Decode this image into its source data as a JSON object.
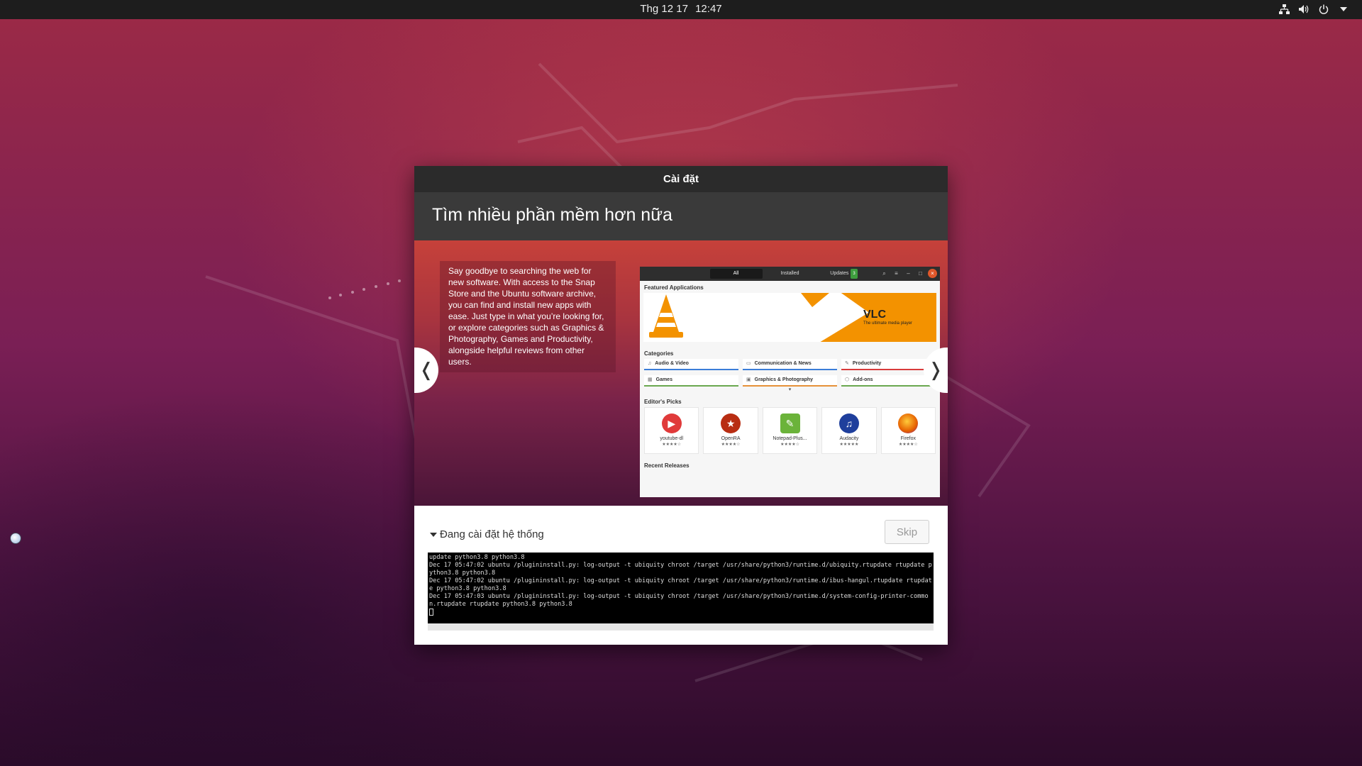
{
  "topbar": {
    "date": "Thg 12 17",
    "time": "12:47",
    "tray_icons": [
      "network-icon",
      "volume-icon",
      "power-icon",
      "dropdown-arrow-icon"
    ]
  },
  "window": {
    "title": "Cài đặt",
    "slide_title": "Tìm nhiều phần mềm hơn nữa",
    "slide_text": "Say goodbye to searching the web for new software. With access to the Snap Store and the Ubuntu software archive, you can find and install new apps with ease. Just type in what you’re looking for, or explore categories such as Graphics & Photography, Games and Productivity, alongside helpful reviews from other users.",
    "nav_prev": "❬",
    "nav_next": "❭"
  },
  "store": {
    "tabs": [
      "All",
      "Installed",
      "Updates"
    ],
    "updates_badge": "3",
    "featured_label": "Featured Applications",
    "featured_app": "VLC",
    "featured_tagline": "The ultimate media player",
    "categories_label": "Categories",
    "categories": [
      {
        "label": "Audio & Video",
        "color": "#3b7dd8"
      },
      {
        "label": "Communication & News",
        "color": "#3b7dd8"
      },
      {
        "label": "Productivity",
        "color": "#d83b3b"
      },
      {
        "label": "Games",
        "color": "#6aa84f"
      },
      {
        "label": "Graphics & Photography",
        "color": "#e69138"
      },
      {
        "label": "Add-ons",
        "color": "#6aa84f"
      }
    ],
    "editors_picks_label": "Editor's Picks",
    "picks": [
      {
        "name": "youtube-dl",
        "stars": "★★★★☆",
        "color": "#e03a3a"
      },
      {
        "name": "OpenRA",
        "stars": "★★★★☆",
        "color": "#b82d12"
      },
      {
        "name": "Notepad-Plus...",
        "stars": "★★★★☆",
        "color": "#6bb33a"
      },
      {
        "name": "Audacity",
        "stars": "★★★★★",
        "color": "#1f3f9c"
      },
      {
        "name": "Firefox",
        "stars": "★★★★☆",
        "color": "#e66000"
      }
    ],
    "recent_label": "Recent Releases"
  },
  "progress": {
    "label": "Đang cài đặt hệ thống",
    "skip_label": "Skip",
    "terminal_lines": [
      "update python3.8 python3.8",
      "Dec 17 05:47:02 ubuntu /plugininstall.py: log-output -t ubiquity chroot /target /usr/share/python3/runtime.d/ubiquity.rtupdate rtupdate python3.8 python3.8",
      "Dec 17 05:47:02 ubuntu /plugininstall.py: log-output -t ubiquity chroot /target /usr/share/python3/runtime.d/ibus-hangul.rtupdate rtupdate python3.8 python3.8",
      "Dec 17 05:47:03 ubuntu /plugininstall.py: log-output -t ubiquity chroot /target /usr/share/python3/runtime.d/system-config-printer-common.rtupdate rtupdate python3.8 python3.8"
    ]
  }
}
